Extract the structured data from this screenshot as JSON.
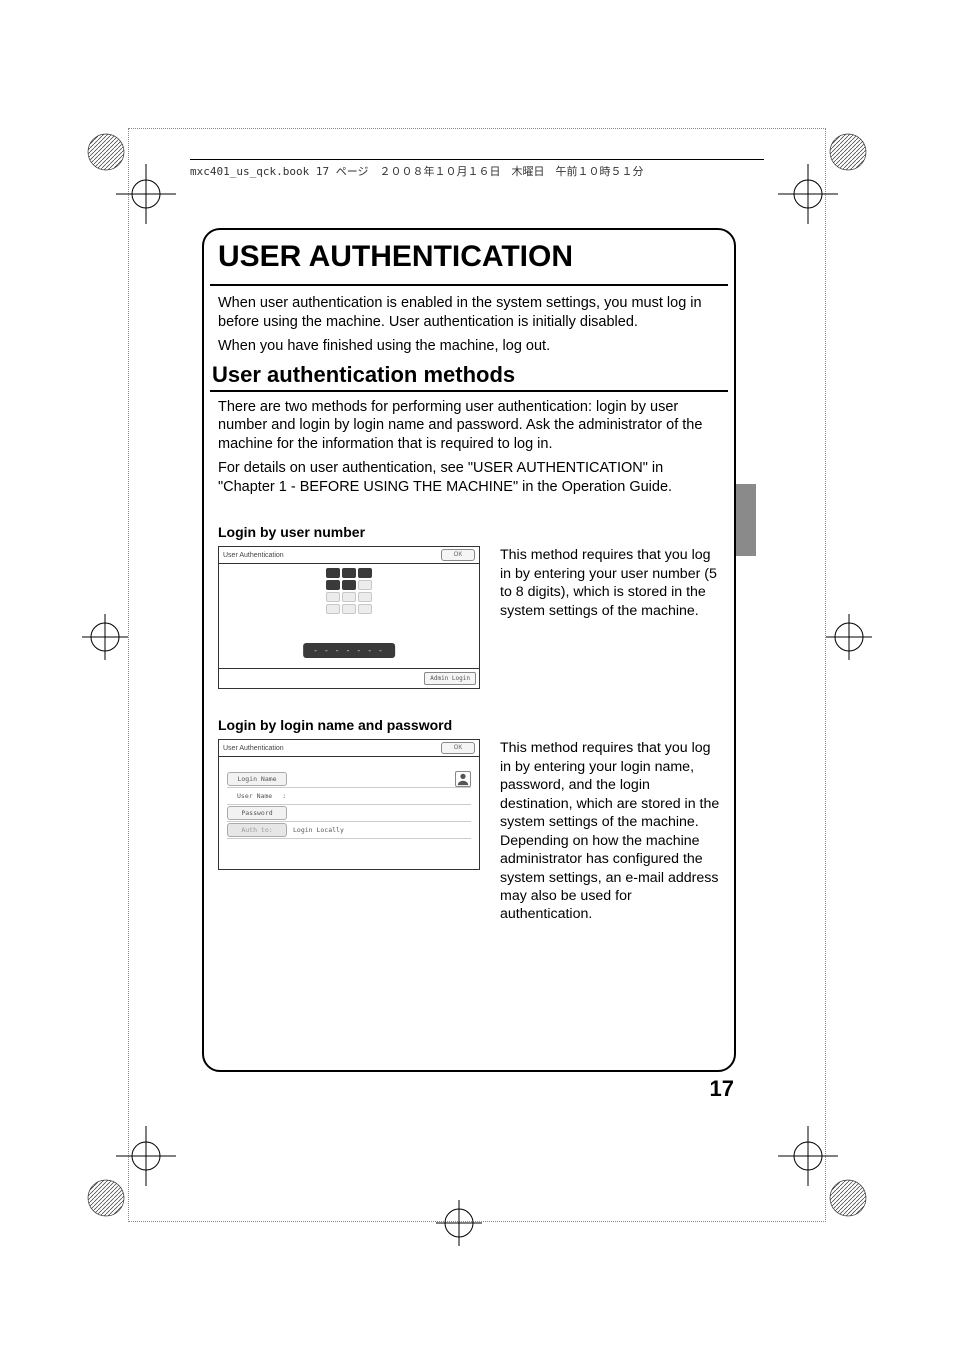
{
  "header_line": "mxc401_us_qck.book  17 ページ　２００８年１０月１６日　木曜日　午前１０時５１分",
  "title": "USER AUTHENTICATION",
  "intro1": "When user authentication is enabled in the system settings, you must log in before using the machine. User authentication is initially disabled.",
  "intro2": "When you have finished using the machine, log out.",
  "section_title": "User authentication methods",
  "section_body1": "There are two methods for performing user authentication: login by user number and login by login name and password. Ask the administrator of the machine for the information that is required to log in.",
  "section_body2": "For details on user authentication, see \"USER AUTHENTICATION\" in \"Chapter 1 - BEFORE USING THE MACHINE\" in the Operation Guide.",
  "method1": {
    "heading": "Login by user number",
    "desc": "This method requires that you log in by entering your user number (5 to 8 digits), which is stored in the system settings of the machine.",
    "panel_title": "User Authentication",
    "ok": "OK",
    "admin": "Admin Login",
    "digits": "-------"
  },
  "method2": {
    "heading": "Login by login name and password",
    "desc": "This method requires that you log in by entering your login name, password, and the login destination, which are stored in the system settings of the machine. Depending on how the machine administrator has configured the system settings, an e-mail address may also be used for authentication.",
    "panel_title": "User Authentication",
    "ok": "OK",
    "login_name": "Login Name",
    "user_name_label": "User Name",
    "user_name_colon": ":",
    "password": "Password",
    "auth_to": "Auth to:",
    "login_locally": "Login Locally"
  },
  "page_number": "17"
}
